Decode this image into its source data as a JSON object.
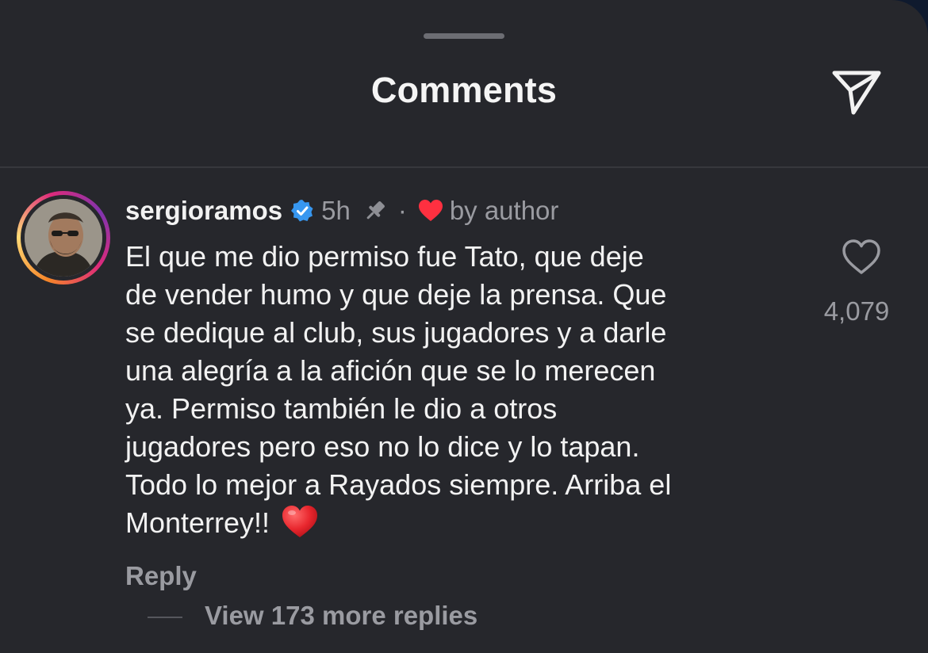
{
  "header": {
    "title": "Comments",
    "share_icon": "send-icon"
  },
  "comment": {
    "username": "sergioramos",
    "verified_icon": "verified-badge-icon",
    "time": "5h",
    "pinned_icon": "pin-icon",
    "separator": "·",
    "liked_by_author_icon": "red-heart-icon",
    "liked_by_author_label": "by author",
    "lines": [
      "El que me dio permiso fue Tato, que deje",
      "de vender humo y que deje la prensa.  Que",
      "se dedique al club, sus jugadores y a darle",
      "una alegría a la afición que se lo merecen",
      "ya.  Permiso también le dio a otros",
      "jugadores pero eso no lo dice y lo tapan.",
      "Todo lo mejor a Rayados siempre. Arriba el",
      "Monterrey!!"
    ],
    "trailing_emoji": "red-heart-emoji",
    "like_count": "4,079",
    "reply_label": "Reply",
    "view_replies_label": "View 173 more replies"
  },
  "colors": {
    "background": "#26272c",
    "text": "#f2f2f2",
    "secondary_text": "#9a9ba1",
    "verified": "#3797f0",
    "heart_red": "#ff3040"
  }
}
